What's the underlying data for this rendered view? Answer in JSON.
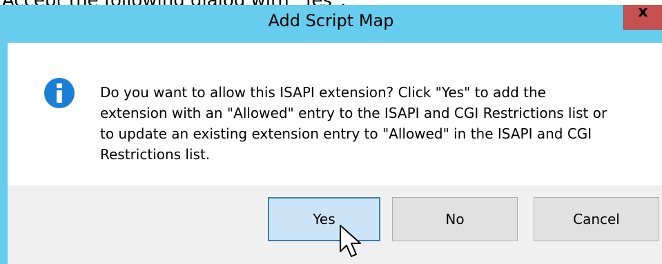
{
  "caption": "Accept the following dialog with \"Yes\":",
  "dialog": {
    "title": "Add Script Map",
    "close_label": "x",
    "icon": "info-icon",
    "message": "Do you want to allow this ISAPI extension? Click \"Yes\" to add the extension with an \"Allowed\" entry to the ISAPI and CGI Restrictions list or to update an existing extension entry to \"Allowed\" in the ISAPI and CGI Restrictions list.",
    "buttons": {
      "yes": "Yes",
      "no": "No",
      "cancel": "Cancel"
    }
  },
  "colors": {
    "titlebar": "#66cdee",
    "close_button": "#c75050",
    "default_button": "#cce4f7",
    "info_icon": "#1c7fd6"
  }
}
